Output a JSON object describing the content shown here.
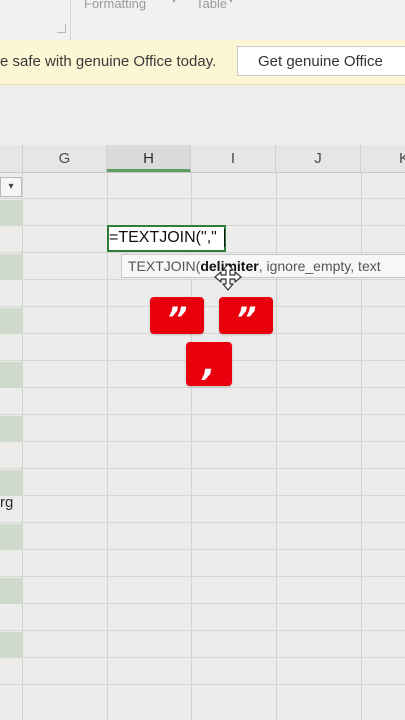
{
  "ribbon": {
    "formatting_label": "Formatting",
    "table_label": "Table"
  },
  "notification": {
    "message": "e safe with genuine Office today.",
    "button_label": "Get genuine Office"
  },
  "grid": {
    "columns": [
      {
        "letter": "G",
        "active": false
      },
      {
        "letter": "H",
        "active": true
      },
      {
        "letter": "I",
        "active": false
      },
      {
        "letter": "J",
        "active": false
      },
      {
        "letter": "K",
        "active": false
      }
    ],
    "left_cell_text": "rg",
    "filter_glyph": "▾"
  },
  "active_cell": {
    "formula": "=TEXTJOIN(\",\""
  },
  "tooltip": {
    "function_name": "TEXTJOIN(",
    "current_arg": "delimiter",
    "rest": ", ignore_empty, text"
  },
  "stickers": [
    {
      "label": "”"
    },
    {
      "label": "”"
    },
    {
      "label": ","
    }
  ],
  "colors": {
    "accent": "#2e7d3a",
    "sticker": "#e8000c",
    "notification_bg": "#fcf6d5"
  }
}
